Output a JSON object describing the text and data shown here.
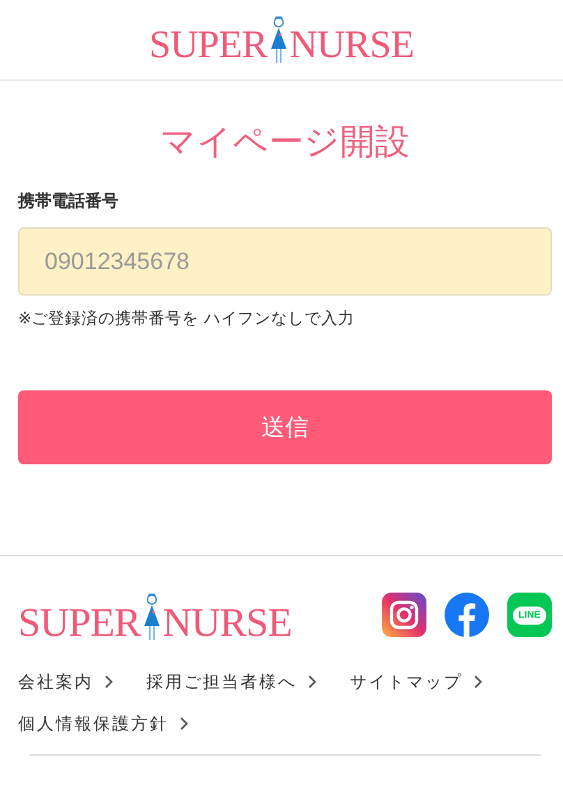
{
  "header": {
    "logo": {
      "left": "SUPER",
      "right": "NURSE"
    }
  },
  "title": "マイページ開設",
  "form": {
    "label": "携帯電話番号",
    "phone_field": {
      "placeholder": "09012345678"
    },
    "note": "※ご登録済の携帯番号を ハイフンなしで入力",
    "submit": "送信"
  },
  "footer": {
    "logo": {
      "left": "SUPER",
      "right": "NURSE"
    },
    "social": [
      {
        "kind": "instagram"
      },
      {
        "kind": "facebook"
      },
      {
        "kind": "line",
        "label": "LINE"
      }
    ],
    "links": [
      {
        "label": "会社案内"
      },
      {
        "label": "採用ご担当者様へ"
      },
      {
        "label": "サイトマップ"
      },
      {
        "label": "個人情報保護方針"
      }
    ]
  }
}
